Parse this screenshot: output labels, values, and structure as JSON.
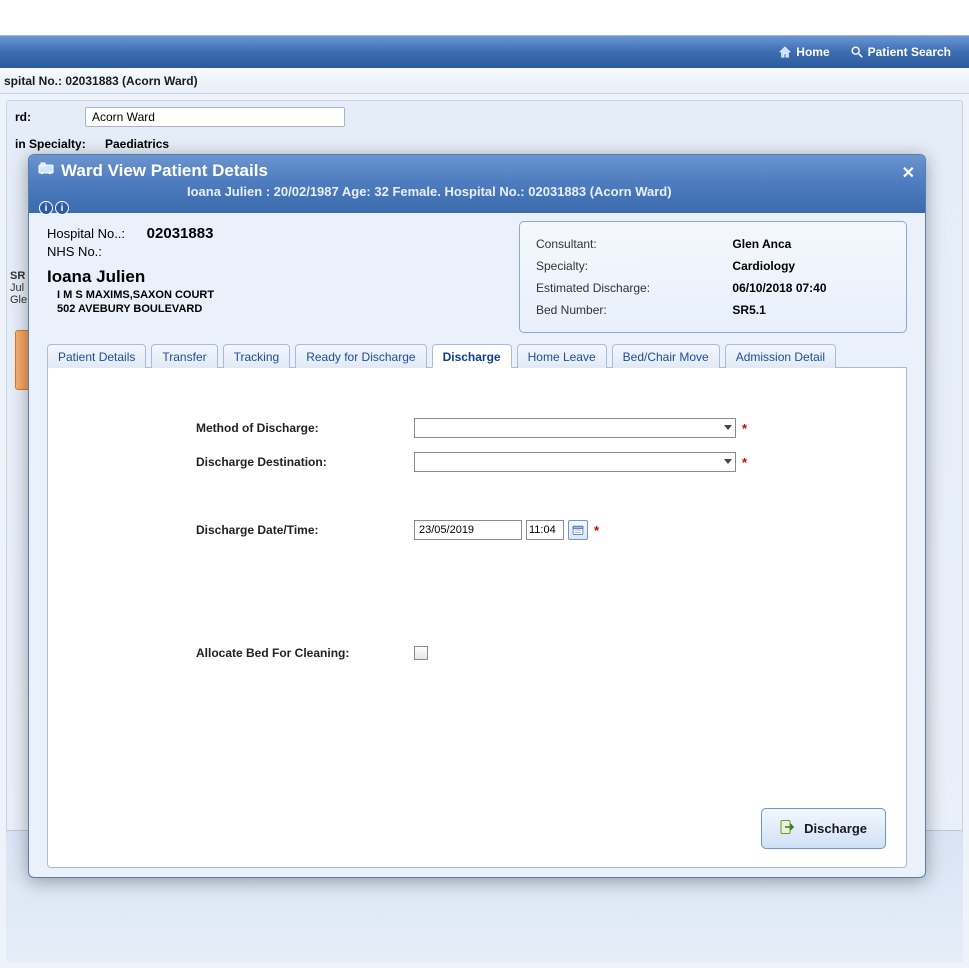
{
  "nav": {
    "home": "Home",
    "patient_search": "Patient Search"
  },
  "breadcrumb": "spital No.: 02031883 (Acorn Ward)",
  "bg": {
    "ward_label": "rd:",
    "ward_value": "Acorn Ward",
    "specialty_label": "in Specialty:",
    "specialty_value": "Paediatrics"
  },
  "side": {
    "sr": "SR",
    "line1": "Jul",
    "line2": "Gle"
  },
  "modal": {
    "title": "Ward View Patient Details",
    "subtitle": "Ioana Julien : 20/02/1987 Age: 32  Female. Hospital No.: 02031883 (Acorn Ward)"
  },
  "left_info": {
    "hosp_label": "Hospital No..:",
    "hosp_value": "02031883",
    "nhs_label": "NHS No.:",
    "name": "Ioana Julien",
    "addr1": "I M S MAXIMS,SAXON COURT",
    "addr2": "502 AVEBURY BOULEVARD"
  },
  "right_info": {
    "consultant_k": "Consultant:",
    "consultant_v": "Glen Anca",
    "specialty_k": "Specialty:",
    "specialty_v": "Cardiology",
    "est_k": "Estimated Discharge:",
    "est_v": "06/10/2018 07:40",
    "bed_k": "Bed Number:",
    "bed_v": "SR5.1"
  },
  "tabs": [
    "Patient Details",
    "Transfer",
    "Tracking",
    "Ready for Discharge",
    "Discharge",
    "Home Leave",
    "Bed/Chair Move",
    "Admission Detail"
  ],
  "active_tab_index": 4,
  "form": {
    "method_label": "Method of Discharge:",
    "dest_label": "Discharge Destination:",
    "dt_label": "Discharge Date/Time:",
    "date_value": "23/05/2019",
    "time_value": "11:04",
    "alloc_label": "Allocate Bed For Cleaning:",
    "required": "*"
  },
  "buttons": {
    "discharge": "Discharge"
  }
}
